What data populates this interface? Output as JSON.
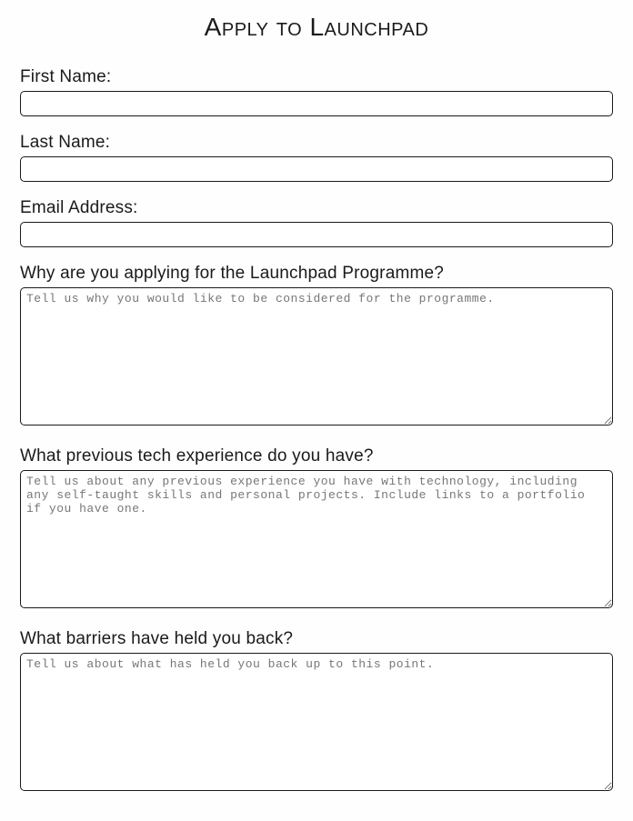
{
  "title": "Apply to Launchpad",
  "fields": {
    "first_name": {
      "label": "First Name:",
      "value": ""
    },
    "last_name": {
      "label": "Last Name:",
      "value": ""
    },
    "email": {
      "label": "Email Address:",
      "value": ""
    },
    "why_applying": {
      "label": "Why are you applying for the Launchpad Programme?",
      "placeholder": "Tell us why you would like to be considered for the programme.",
      "value": ""
    },
    "tech_experience": {
      "label": "What previous tech experience do you have?",
      "placeholder": "Tell us about any previous experience you have with technology, including any self-taught skills and personal projects. Include links to a portfolio if you have one.",
      "value": ""
    },
    "barriers": {
      "label": "What barriers have held you back?",
      "placeholder": "Tell us about what has held you back up to this point.",
      "value": ""
    }
  }
}
